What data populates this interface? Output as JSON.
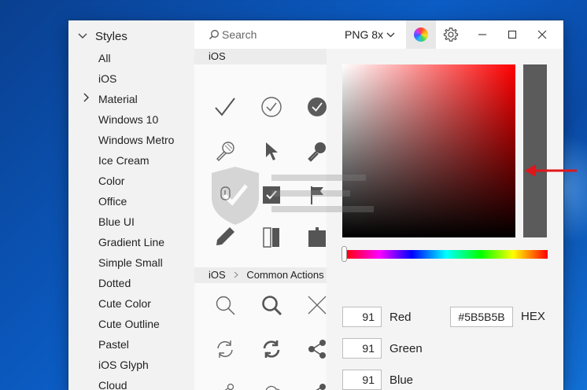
{
  "sidebar": {
    "header": "Styles",
    "items": [
      {
        "label": "All",
        "expandable": false
      },
      {
        "label": "iOS",
        "expandable": false
      },
      {
        "label": "Material",
        "expandable": true
      },
      {
        "label": "Windows 10",
        "expandable": false
      },
      {
        "label": "Windows Metro",
        "expandable": false
      },
      {
        "label": "Ice Cream",
        "expandable": false
      },
      {
        "label": "Color",
        "expandable": false
      },
      {
        "label": "Office",
        "expandable": false
      },
      {
        "label": "Blue UI",
        "expandable": false
      },
      {
        "label": "Gradient Line",
        "expandable": false
      },
      {
        "label": "Simple Small",
        "expandable": false
      },
      {
        "label": "Dotted",
        "expandable": false
      },
      {
        "label": "Cute Color",
        "expandable": false
      },
      {
        "label": "Cute Outline",
        "expandable": false
      },
      {
        "label": "Pastel",
        "expandable": false
      },
      {
        "label": "iOS Glyph",
        "expandable": false
      },
      {
        "label": "Cloud",
        "expandable": false
      }
    ]
  },
  "toolbar": {
    "search_placeholder": "Search",
    "format": "PNG 8x"
  },
  "grid": {
    "section1": "iOS",
    "section1_icons": [
      "checkmark-icon",
      "checkmark-circle-icon",
      "checkmark-filled-circle-icon",
      "microphone-icon",
      "cursor-icon",
      "microphone-filled-icon",
      "touch-icon",
      "checkbox-filled-icon",
      "flag-icon",
      "pencil-icon",
      "battery-icon",
      "puzzle-icon"
    ],
    "section2_crumbs": [
      "iOS",
      "Common Actions"
    ],
    "section2_icons": [
      "search-icon",
      "search-bold-icon",
      "close-icon",
      "refresh-icon",
      "refresh-bold-icon",
      "share-filled-icon",
      "share-icon",
      "cloud-download-icon",
      "share-filled-icon"
    ]
  },
  "picker": {
    "color": "#5b5b5b",
    "hue_color": "#ff0000",
    "red": {
      "label": "Red",
      "value": "91"
    },
    "green": {
      "label": "Green",
      "value": "91"
    },
    "blue": {
      "label": "Blue",
      "value": "91"
    },
    "hex": {
      "label": "HEX",
      "value": "#5B5B5B"
    }
  },
  "colors": {
    "accent_annotation": "#e0161b",
    "desktop": "#0b5cc4"
  }
}
